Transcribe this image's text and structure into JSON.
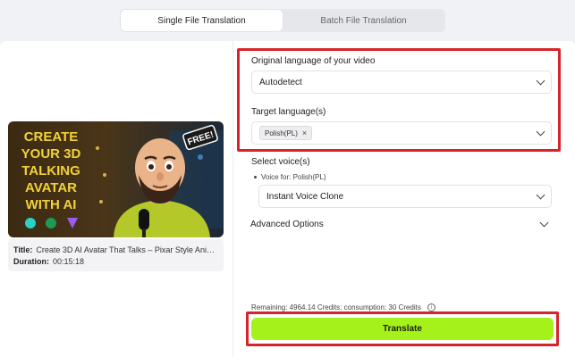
{
  "tabs": [
    {
      "label": "Single File Translation",
      "active": true
    },
    {
      "label": "Batch File Translation",
      "active": false
    }
  ],
  "video": {
    "thumbnail_text": [
      "CREATE",
      "YOUR 3D",
      "TALKING",
      "AVATAR",
      "WITH AI"
    ],
    "free_badge": "FREE!",
    "title_label": "Title:",
    "title_value": "Create 3D AI Avatar That Talks – Pixar Style Anim...",
    "duration_label": "Duration:",
    "duration_value": "00:15:18"
  },
  "original_language": {
    "label": "Original language of your video",
    "value": "Autodetect"
  },
  "target_language": {
    "label": "Target language(s)",
    "tags": [
      "Polish(PL)"
    ]
  },
  "voice": {
    "label": "Select voice(s)",
    "voice_for": "Voice for: Polish(PL)",
    "value": "Instant Voice Clone"
  },
  "advanced": {
    "label": "Advanced Options"
  },
  "credits": {
    "text": "Remaining: 4964.14 Credits; consumption: 30 Credits",
    "info": "i"
  },
  "translate": {
    "label": "Translate"
  },
  "colors": {
    "accent": "#a4f219",
    "highlight": "#d8232a"
  }
}
